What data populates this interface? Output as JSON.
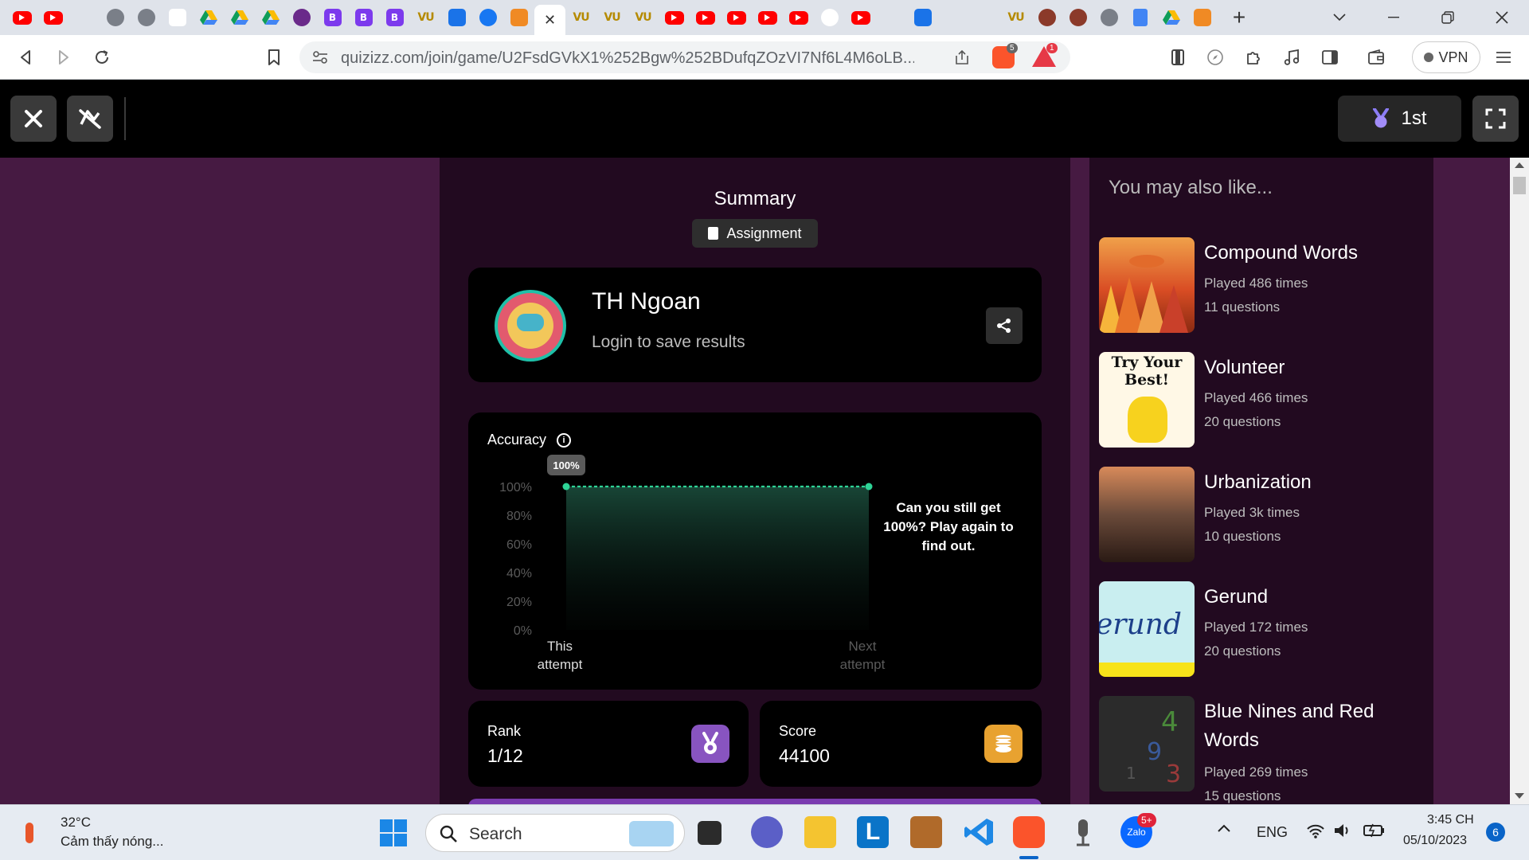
{
  "browser": {
    "tab_close_label": "✕",
    "new_tab_label": "+",
    "tab_icons": [
      "youtube-icon",
      "youtube-icon",
      "code-icon",
      "globe-icon",
      "globe-icon",
      "gmail-icon",
      "google-drive-icon",
      "google-drive-icon",
      "google-drive-icon",
      "chat-icon",
      "b-icon",
      "b-icon",
      "b-icon",
      "vu-icon",
      "translate-icon",
      "facebook-icon",
      "app-icon",
      "quizizz-tab",
      "vu-icon",
      "vu-icon",
      "vu-icon",
      "youtube-icon",
      "youtube-icon",
      "youtube-icon",
      "youtube-icon",
      "youtube-icon",
      "google-icon",
      "youtube-icon",
      "speaker-icon",
      "ai-icon",
      "triangle-icon",
      "triangle-icon",
      "vu-icon",
      "avatar-icon",
      "avatar-icon",
      "globe-icon",
      "docs-icon",
      "google-drive-icon",
      "app-icon"
    ],
    "vu_text": "VU",
    "b_text": "B",
    "url": "quizizz.com/join/game/U2FsdGVkX1%252Bgw%252BDufqZOzVI7Nf6L4M6oLB...",
    "brave_badge": "5",
    "bat_badge": "1",
    "vpn_label": "VPN"
  },
  "game_header": {
    "rank_label": "1st"
  },
  "summary": {
    "title": "Summary",
    "assignment_label": "Assignment",
    "player_name": "TH Ngoan",
    "login_prompt": "Login to save results"
  },
  "accuracy": {
    "label": "Accuracy",
    "info_glyph": "i",
    "cta": "Can you still get 100%? Play again to find out."
  },
  "chart_data": {
    "type": "area",
    "categories": [
      "This attempt",
      "Next attempt"
    ],
    "values": [
      100,
      100
    ],
    "point_label": "100%",
    "yticks": [
      "100%",
      "80%",
      "60%",
      "40%",
      "20%",
      "0%"
    ],
    "ylim": [
      0,
      100
    ],
    "line_color": "#2ed396"
  },
  "stats": {
    "rank_label": "Rank",
    "rank_value": "1/12",
    "score_label": "Score",
    "score_value": "44100"
  },
  "recommendations": {
    "title": "You may also like...",
    "items": [
      {
        "title": "Compound Words",
        "played": "Played 486 times",
        "questions": "11 questions"
      },
      {
        "title": "Volunteer",
        "played": "Played 466 times",
        "questions": "20 questions"
      },
      {
        "title": "Urbanization",
        "played": "Played 3k times",
        "questions": "10 questions"
      },
      {
        "title": "Gerund",
        "played": "Played 172 times",
        "questions": "20 questions"
      },
      {
        "title": "Blue Nines and Red Words",
        "played": "Played 269 times",
        "questions": "15 questions"
      }
    ],
    "thumb_texts": {
      "volunteer": "Try Your Best!",
      "gerund": "erund"
    }
  },
  "taskbar": {
    "temperature": "32°C",
    "weather": "Cảm thấy nóng...",
    "search_label": "Search",
    "language": "ENG",
    "time": "3:45 CH",
    "date": "05/10/2023",
    "notifications": "6",
    "zalo_badge": "5+"
  }
}
